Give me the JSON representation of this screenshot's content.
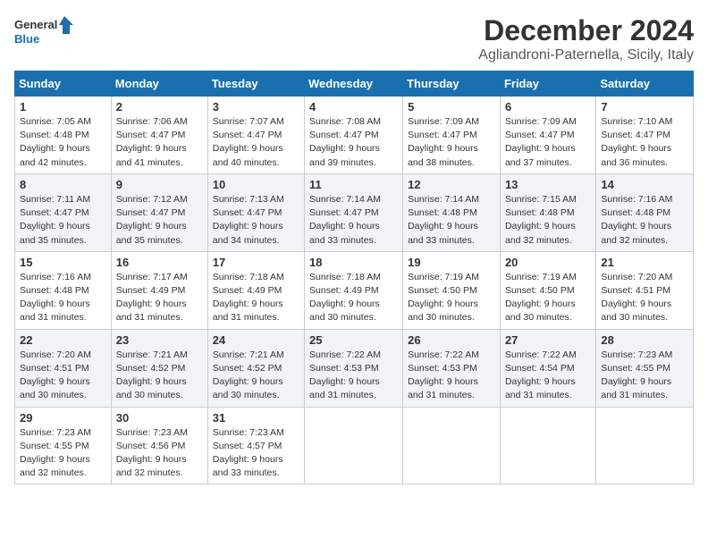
{
  "logo": {
    "text_general": "General",
    "text_blue": "Blue"
  },
  "header": {
    "month_title": "December 2024",
    "subtitle": "Agliandroni-Paternella, Sicily, Italy"
  },
  "weekdays": [
    "Sunday",
    "Monday",
    "Tuesday",
    "Wednesday",
    "Thursday",
    "Friday",
    "Saturday"
  ],
  "weeks": [
    [
      {
        "day": "1",
        "sunrise": "Sunrise: 7:05 AM",
        "sunset": "Sunset: 4:48 PM",
        "daylight": "Daylight: 9 hours and 42 minutes."
      },
      {
        "day": "2",
        "sunrise": "Sunrise: 7:06 AM",
        "sunset": "Sunset: 4:47 PM",
        "daylight": "Daylight: 9 hours and 41 minutes."
      },
      {
        "day": "3",
        "sunrise": "Sunrise: 7:07 AM",
        "sunset": "Sunset: 4:47 PM",
        "daylight": "Daylight: 9 hours and 40 minutes."
      },
      {
        "day": "4",
        "sunrise": "Sunrise: 7:08 AM",
        "sunset": "Sunset: 4:47 PM",
        "daylight": "Daylight: 9 hours and 39 minutes."
      },
      {
        "day": "5",
        "sunrise": "Sunrise: 7:09 AM",
        "sunset": "Sunset: 4:47 PM",
        "daylight": "Daylight: 9 hours and 38 minutes."
      },
      {
        "day": "6",
        "sunrise": "Sunrise: 7:09 AM",
        "sunset": "Sunset: 4:47 PM",
        "daylight": "Daylight: 9 hours and 37 minutes."
      },
      {
        "day": "7",
        "sunrise": "Sunrise: 7:10 AM",
        "sunset": "Sunset: 4:47 PM",
        "daylight": "Daylight: 9 hours and 36 minutes."
      }
    ],
    [
      {
        "day": "8",
        "sunrise": "Sunrise: 7:11 AM",
        "sunset": "Sunset: 4:47 PM",
        "daylight": "Daylight: 9 hours and 35 minutes."
      },
      {
        "day": "9",
        "sunrise": "Sunrise: 7:12 AM",
        "sunset": "Sunset: 4:47 PM",
        "daylight": "Daylight: 9 hours and 35 minutes."
      },
      {
        "day": "10",
        "sunrise": "Sunrise: 7:13 AM",
        "sunset": "Sunset: 4:47 PM",
        "daylight": "Daylight: 9 hours and 34 minutes."
      },
      {
        "day": "11",
        "sunrise": "Sunrise: 7:14 AM",
        "sunset": "Sunset: 4:47 PM",
        "daylight": "Daylight: 9 hours and 33 minutes."
      },
      {
        "day": "12",
        "sunrise": "Sunrise: 7:14 AM",
        "sunset": "Sunset: 4:48 PM",
        "daylight": "Daylight: 9 hours and 33 minutes."
      },
      {
        "day": "13",
        "sunrise": "Sunrise: 7:15 AM",
        "sunset": "Sunset: 4:48 PM",
        "daylight": "Daylight: 9 hours and 32 minutes."
      },
      {
        "day": "14",
        "sunrise": "Sunrise: 7:16 AM",
        "sunset": "Sunset: 4:48 PM",
        "daylight": "Daylight: 9 hours and 32 minutes."
      }
    ],
    [
      {
        "day": "15",
        "sunrise": "Sunrise: 7:16 AM",
        "sunset": "Sunset: 4:48 PM",
        "daylight": "Daylight: 9 hours and 31 minutes."
      },
      {
        "day": "16",
        "sunrise": "Sunrise: 7:17 AM",
        "sunset": "Sunset: 4:49 PM",
        "daylight": "Daylight: 9 hours and 31 minutes."
      },
      {
        "day": "17",
        "sunrise": "Sunrise: 7:18 AM",
        "sunset": "Sunset: 4:49 PM",
        "daylight": "Daylight: 9 hours and 31 minutes."
      },
      {
        "day": "18",
        "sunrise": "Sunrise: 7:18 AM",
        "sunset": "Sunset: 4:49 PM",
        "daylight": "Daylight: 9 hours and 30 minutes."
      },
      {
        "day": "19",
        "sunrise": "Sunrise: 7:19 AM",
        "sunset": "Sunset: 4:50 PM",
        "daylight": "Daylight: 9 hours and 30 minutes."
      },
      {
        "day": "20",
        "sunrise": "Sunrise: 7:19 AM",
        "sunset": "Sunset: 4:50 PM",
        "daylight": "Daylight: 9 hours and 30 minutes."
      },
      {
        "day": "21",
        "sunrise": "Sunrise: 7:20 AM",
        "sunset": "Sunset: 4:51 PM",
        "daylight": "Daylight: 9 hours and 30 minutes."
      }
    ],
    [
      {
        "day": "22",
        "sunrise": "Sunrise: 7:20 AM",
        "sunset": "Sunset: 4:51 PM",
        "daylight": "Daylight: 9 hours and 30 minutes."
      },
      {
        "day": "23",
        "sunrise": "Sunrise: 7:21 AM",
        "sunset": "Sunset: 4:52 PM",
        "daylight": "Daylight: 9 hours and 30 minutes."
      },
      {
        "day": "24",
        "sunrise": "Sunrise: 7:21 AM",
        "sunset": "Sunset: 4:52 PM",
        "daylight": "Daylight: 9 hours and 30 minutes."
      },
      {
        "day": "25",
        "sunrise": "Sunrise: 7:22 AM",
        "sunset": "Sunset: 4:53 PM",
        "daylight": "Daylight: 9 hours and 31 minutes."
      },
      {
        "day": "26",
        "sunrise": "Sunrise: 7:22 AM",
        "sunset": "Sunset: 4:53 PM",
        "daylight": "Daylight: 9 hours and 31 minutes."
      },
      {
        "day": "27",
        "sunrise": "Sunrise: 7:22 AM",
        "sunset": "Sunset: 4:54 PM",
        "daylight": "Daylight: 9 hours and 31 minutes."
      },
      {
        "day": "28",
        "sunrise": "Sunrise: 7:23 AM",
        "sunset": "Sunset: 4:55 PM",
        "daylight": "Daylight: 9 hours and 31 minutes."
      }
    ],
    [
      {
        "day": "29",
        "sunrise": "Sunrise: 7:23 AM",
        "sunset": "Sunset: 4:55 PM",
        "daylight": "Daylight: 9 hours and 32 minutes."
      },
      {
        "day": "30",
        "sunrise": "Sunrise: 7:23 AM",
        "sunset": "Sunset: 4:56 PM",
        "daylight": "Daylight: 9 hours and 32 minutes."
      },
      {
        "day": "31",
        "sunrise": "Sunrise: 7:23 AM",
        "sunset": "Sunset: 4:57 PM",
        "daylight": "Daylight: 9 hours and 33 minutes."
      },
      null,
      null,
      null,
      null
    ]
  ]
}
